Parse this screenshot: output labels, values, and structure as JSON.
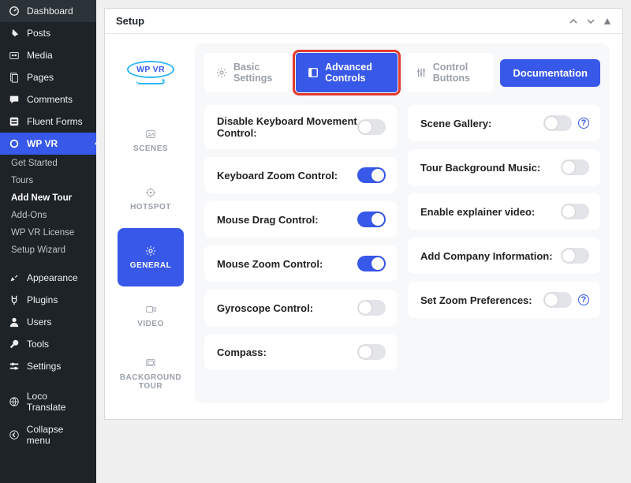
{
  "admin_menu": {
    "items": [
      {
        "label": "Dashboard",
        "icon": "dashboard"
      },
      {
        "label": "Posts",
        "icon": "pin"
      },
      {
        "label": "Media",
        "icon": "media"
      },
      {
        "label": "Pages",
        "icon": "pages"
      },
      {
        "label": "Comments",
        "icon": "comments"
      },
      {
        "label": "Fluent Forms",
        "icon": "forms"
      },
      {
        "label": "WP VR",
        "icon": "wpvr",
        "active": true
      }
    ],
    "sub_items": [
      {
        "label": "Get Started"
      },
      {
        "label": "Tours"
      },
      {
        "label": "Add New Tour",
        "current": true
      },
      {
        "label": "Add-Ons"
      },
      {
        "label": "WP VR License"
      },
      {
        "label": "Setup Wizard"
      }
    ],
    "items_lower": [
      {
        "label": "Appearance",
        "icon": "appearance"
      },
      {
        "label": "Plugins",
        "icon": "plugins"
      },
      {
        "label": "Users",
        "icon": "users"
      },
      {
        "label": "Tools",
        "icon": "tools"
      },
      {
        "label": "Settings",
        "icon": "settings"
      },
      {
        "label": "Loco Translate",
        "icon": "loco"
      },
      {
        "label": "Collapse menu",
        "icon": "collapse"
      }
    ]
  },
  "metabox": {
    "title": "Setup"
  },
  "tabs": {
    "logo_text": "WP VR",
    "vtabs": [
      {
        "label": "SCENES",
        "icon": "image"
      },
      {
        "label": "HOTSPOT",
        "icon": "target"
      },
      {
        "label": "GENERAL",
        "icon": "gear",
        "active": true
      },
      {
        "label": "VIDEO",
        "icon": "video"
      },
      {
        "label": "BACKGROUND TOUR",
        "icon": "bgtour"
      }
    ]
  },
  "top_tabs": {
    "items": [
      {
        "label": "Basic Settings",
        "icon": "gear"
      },
      {
        "label": "Advanced Controls",
        "icon": "panel",
        "active": true,
        "highlight": true
      },
      {
        "label": "Control Buttons",
        "icon": "sliders"
      }
    ],
    "documentation": "Documentation"
  },
  "settings": {
    "left": [
      {
        "label": "Disable Keyboard Movement Control:",
        "on": false,
        "info": false
      },
      {
        "label": "Keyboard Zoom Control:",
        "on": true,
        "info": false
      },
      {
        "label": "Mouse Drag Control:",
        "on": true,
        "info": false
      },
      {
        "label": "Mouse Zoom Control:",
        "on": true,
        "info": false
      },
      {
        "label": "Gyroscope Control:",
        "on": false,
        "info": false
      },
      {
        "label": "Compass:",
        "on": false,
        "info": false
      }
    ],
    "right": [
      {
        "label": "Scene Gallery:",
        "on": false,
        "info": true
      },
      {
        "label": "Tour Background Music:",
        "on": false,
        "info": false
      },
      {
        "label": "Enable explainer video:",
        "on": false,
        "info": false
      },
      {
        "label": "Add Company Information:",
        "on": false,
        "info": false
      },
      {
        "label": "Set Zoom Preferences:",
        "on": false,
        "info": true
      }
    ]
  }
}
